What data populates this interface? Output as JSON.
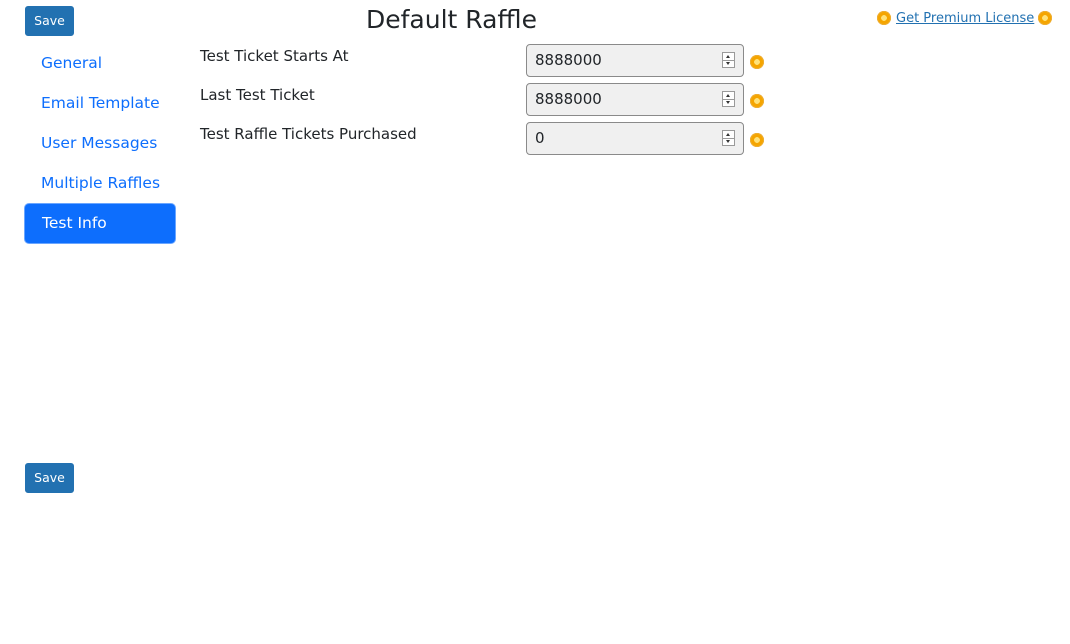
{
  "toolbar": {
    "save_label": "Save"
  },
  "footer": {
    "save_label": "Save"
  },
  "header": {
    "title": "Default Raffle",
    "premium_link": "Get Premium License"
  },
  "sidebar": {
    "items": [
      {
        "label": "General"
      },
      {
        "label": "Email Template"
      },
      {
        "label": "User Messages"
      },
      {
        "label": "Multiple Raffles"
      },
      {
        "label": "Test Info"
      }
    ],
    "active": "Test Info"
  },
  "form": {
    "fields": [
      {
        "label": "Test Ticket Starts At",
        "value": "8888000"
      },
      {
        "label": "Last Test Ticket",
        "value": "8888000"
      },
      {
        "label": "Test Raffle Tickets Purchased",
        "value": "0"
      }
    ]
  },
  "icons": {
    "premium": "premium-coin-icon",
    "spinner_up": "spinner-up-icon",
    "spinner_down": "spinner-down-icon"
  },
  "colors": {
    "save_button": "#2271b1",
    "nav_link": "#0d6efd",
    "nav_active_bg": "#0d6efd",
    "premium_coin": "#f5a500"
  }
}
